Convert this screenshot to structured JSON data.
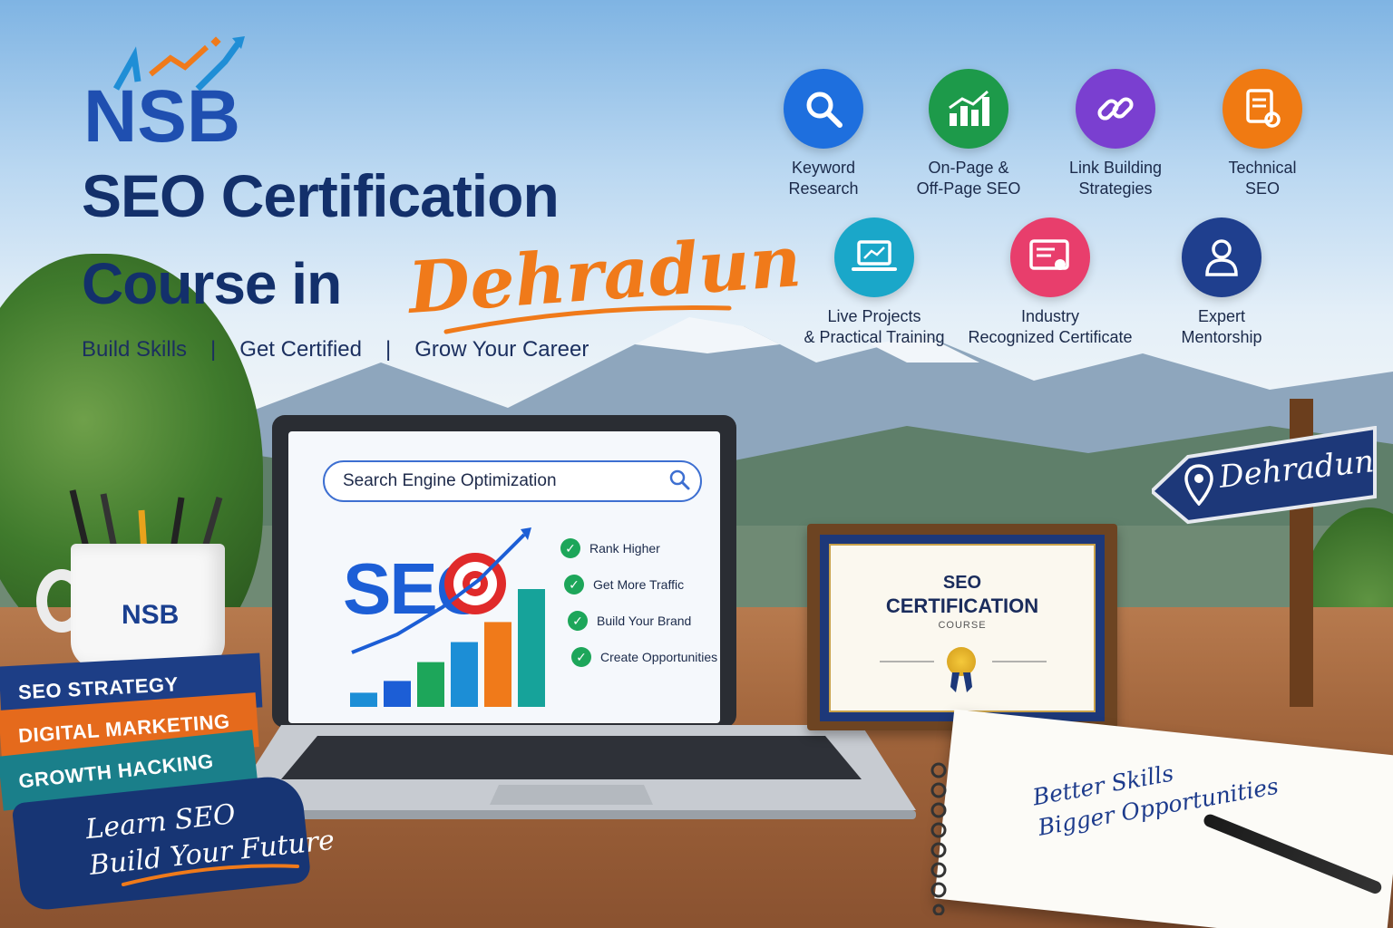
{
  "logo": {
    "text": "NSB"
  },
  "headline": {
    "line1": "SEO Certification",
    "line2": "Course in",
    "script": "Dehradun"
  },
  "tagline": {
    "items": [
      "Build Skills",
      "Get Certified",
      "Grow Your Career"
    ],
    "separator": "|"
  },
  "features": [
    {
      "label_1": "Keyword",
      "label_2": "Research",
      "icon": "magnifier-icon",
      "color": "#1e6fde"
    },
    {
      "label_1": "On-Page &",
      "label_2": "Off-Page SEO",
      "icon": "bar-chart-icon",
      "color": "#1d9a4a"
    },
    {
      "label_1": "Link Building",
      "label_2": "Strategies",
      "icon": "link-icon",
      "color": "#7a3fd0"
    },
    {
      "label_1": "Technical",
      "label_2": "SEO",
      "icon": "document-gear-icon",
      "color": "#f07a12"
    },
    {
      "label_1": "Live Projects",
      "label_2": "& Practical Training",
      "icon": "laptop-icon",
      "color": "#1aa7c9"
    },
    {
      "label_1": "Industry",
      "label_2": "Recognized Certificate",
      "icon": "certificate-icon",
      "color": "#e83e6c"
    },
    {
      "label_1": "Expert",
      "label_2": "Mentorship",
      "icon": "mentor-icon",
      "color": "#1f3f8e"
    }
  ],
  "laptop": {
    "search_text": "Search Engine Optimization",
    "seo_text": "SEO",
    "checklist": [
      "Rank Higher",
      "Get More Traffic",
      "Build Your Brand",
      "Create Opportunities"
    ],
    "bar_colors": [
      "#1c8ed6",
      "#1c5ed6",
      "#1da65a",
      "#1c8ed6",
      "#f07a1a",
      "#16a39a"
    ],
    "bar_levels": [
      0.12,
      0.22,
      0.38,
      0.55,
      0.72,
      1.0
    ]
  },
  "books": [
    "SEO STRATEGY",
    "DIGITAL MARKETING",
    "GROWTH HACKING"
  ],
  "mug": {
    "logo": "NSB"
  },
  "badge": {
    "line1": "Learn SEO",
    "line2": "Build Your Future"
  },
  "certificate": {
    "line1": "SEO",
    "line2": "CERTIFICATION",
    "line3": "COURSE"
  },
  "sign": {
    "text": "Dehradun"
  },
  "notebook": {
    "line1": "Better Skills",
    "line2": "Bigger Opportunities"
  }
}
